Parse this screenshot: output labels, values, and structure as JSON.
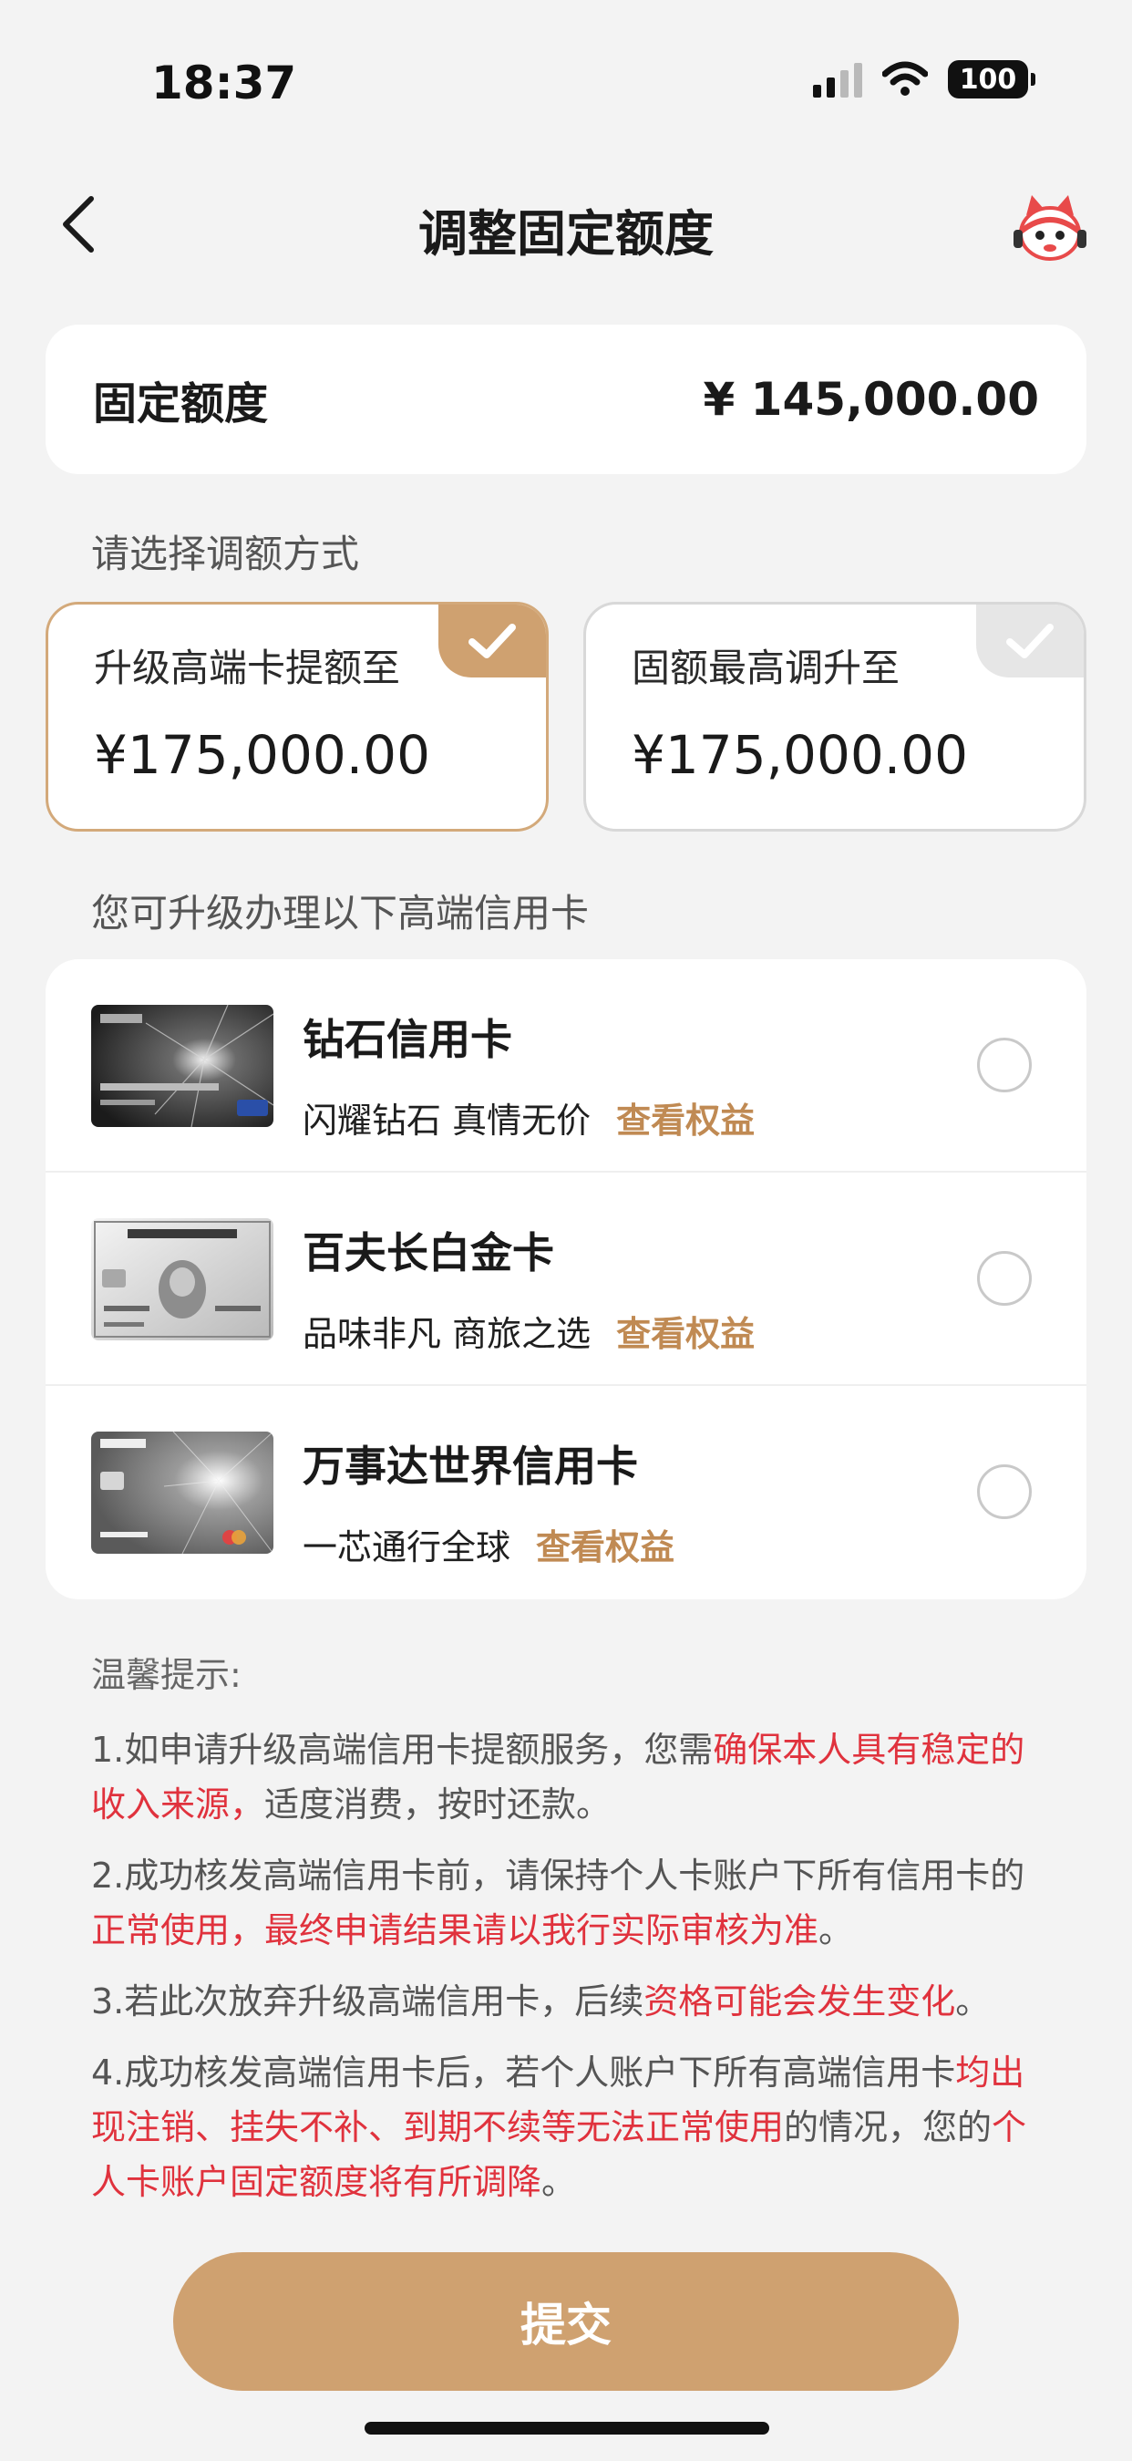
{
  "status_bar": {
    "time": "18:37",
    "battery": "100"
  },
  "header": {
    "title": "调整固定额度"
  },
  "fixed_limit": {
    "label": "固定额度",
    "value": "¥ 145,000.00"
  },
  "adjust_section": {
    "title": "请选择调额方式",
    "options": [
      {
        "label": "升级高端卡提额至",
        "amount": "¥175,000.00",
        "selected": true
      },
      {
        "label": "固额最高调升至",
        "amount": "¥175,000.00",
        "selected": false
      }
    ]
  },
  "cards_section": {
    "title": "您可升级办理以下高端信用卡",
    "cards": [
      {
        "name": "钻石信用卡",
        "desc": "闪耀钻石 真情无价",
        "link": "查看权益",
        "art": "diamond-card-art"
      },
      {
        "name": "百夫长白金卡",
        "desc": "品味非凡 商旅之选",
        "link": "查看权益",
        "art": "amex-platinum-card-art"
      },
      {
        "name": "万事达世界信用卡",
        "desc": "一芯通行全球",
        "link": "查看权益",
        "art": "mastercard-world-card-art"
      }
    ]
  },
  "tips": {
    "title": "温馨提示:",
    "items": [
      [
        {
          "t": "1.如申请升级高端信用卡提额服务，您需",
          "red": false
        },
        {
          "t": "确保本人具有稳定的收入来源，",
          "red": true
        },
        {
          "t": "适度消费，按时还款。",
          "red": false
        }
      ],
      [
        {
          "t": "2.成功核发高端信用卡前，请保持个人卡账户下所有信用卡的",
          "red": false
        },
        {
          "t": "正常使用，最终申请结果请以我行实际审核为准",
          "red": true
        },
        {
          "t": "。",
          "red": false
        }
      ],
      [
        {
          "t": "3.若此次放弃升级高端信用卡，后续",
          "red": false
        },
        {
          "t": "资格可能会发生变化",
          "red": true
        },
        {
          "t": "。",
          "red": false
        }
      ],
      [
        {
          "t": "4.成功核发高端信用卡后，若个人账户下所有高端信用卡",
          "red": false
        },
        {
          "t": "均出现注销、挂失不补、到期不续等无法正常使用",
          "red": true
        },
        {
          "t": "的情况，您的",
          "red": false
        },
        {
          "t": "个人卡账户固定额度将有所调降",
          "red": true
        },
        {
          "t": "。",
          "red": false
        }
      ]
    ]
  },
  "submit": {
    "label": "提交"
  },
  "colors": {
    "accent": "#cfa170",
    "warning": "#e0323d",
    "link": "#c08a53"
  },
  "icons": [
    "back-arrow-icon",
    "mascot-service-icon",
    "check-icon",
    "signal-icon",
    "wifi-icon",
    "battery-icon"
  ]
}
